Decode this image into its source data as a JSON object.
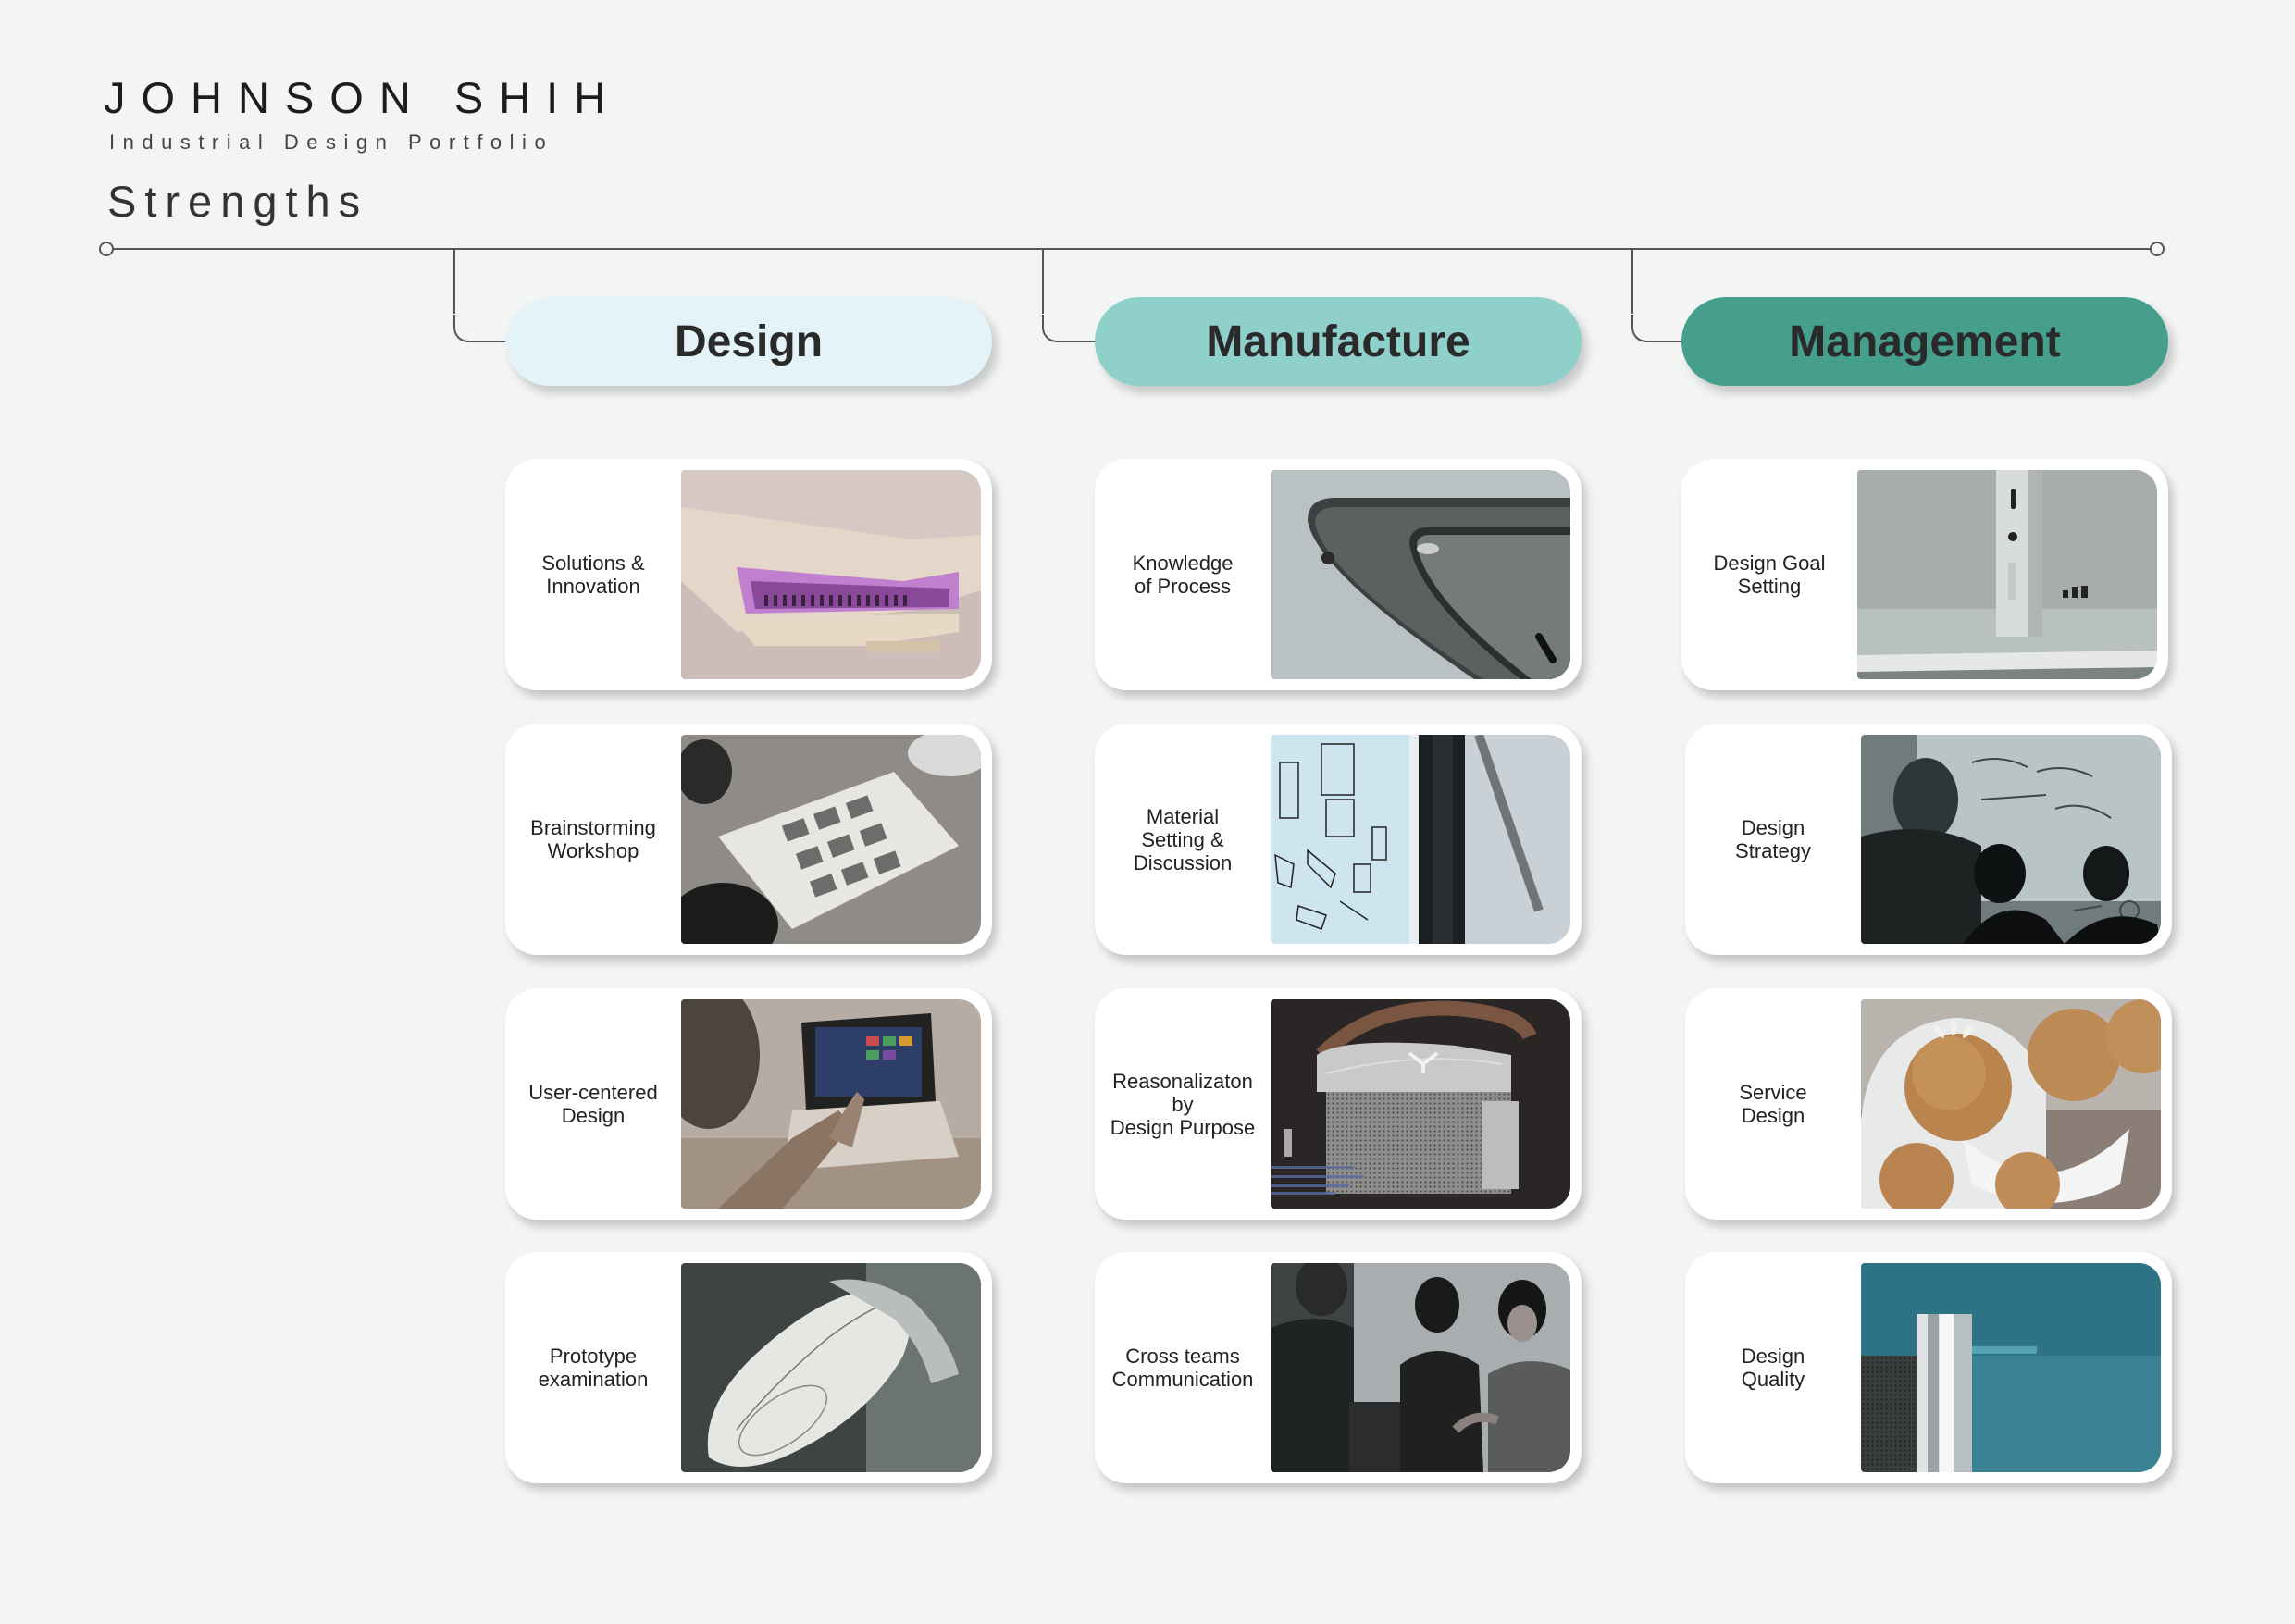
{
  "header": {
    "name": "JOHNSON SHIH",
    "subtitle": "Industrial Design Portfolio",
    "section": "Strengths"
  },
  "columns": [
    {
      "title": "Design",
      "color": "#e3f3f7",
      "cards": [
        {
          "label": "Solutions &\nInnovation",
          "image": "product-hinge-image"
        },
        {
          "label": "Brainstorming\nWorkshop",
          "image": "workshop-table-image"
        },
        {
          "label": "User-centered\nDesign",
          "image": "tablet-use-image"
        },
        {
          "label": "Prototype\nexamination",
          "image": "mouse-prototype-image"
        }
      ]
    },
    {
      "title": "Manufacture",
      "color": "#8fd0cb",
      "cards": [
        {
          "label": "Knowledge\nof Process",
          "image": "laptop-corner-image"
        },
        {
          "label": "Material\nSetting &\nDiscussion",
          "image": "sketch-material-image"
        },
        {
          "label": "Reasonalizaton\nby\nDesign Purpose",
          "image": "speaker-device-image"
        },
        {
          "label": "Cross teams\nCommunication",
          "image": "team-meeting-image"
        }
      ]
    },
    {
      "title": "Management",
      "color": "#469e8c",
      "cards": [
        {
          "label": "Design Goal\nSetting",
          "image": "monitor-stand-image"
        },
        {
          "label": "Design\nStrategy",
          "image": "whiteboard-session-image"
        },
        {
          "label": "Service\nDesign",
          "image": "wooden-spheres-image"
        },
        {
          "label": "Design\nQuality",
          "image": "cylinder-detail-image"
        }
      ]
    }
  ]
}
